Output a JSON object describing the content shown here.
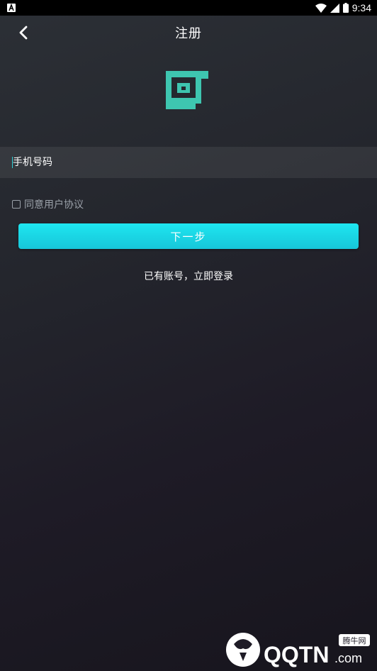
{
  "status_bar": {
    "time": "9:34",
    "icons": [
      "a-notification-icon",
      "wifi-icon",
      "signal-icon",
      "battery-icon"
    ]
  },
  "header": {
    "title": "注册",
    "back_icon": "chevron-left-icon"
  },
  "form": {
    "phone_placeholder": "手机号码",
    "agree_label": "同意用户协议",
    "agree_checked": false,
    "next_label": "下一步",
    "login_link": "已有账号，立即登录"
  },
  "watermark": {
    "brand": "QQTN",
    "suffix": ".com",
    "badge": "腾牛网"
  },
  "colors": {
    "accent": "#1ee6f0",
    "logo": "#3ec6b0",
    "muted_text": "#9aa0a8"
  }
}
